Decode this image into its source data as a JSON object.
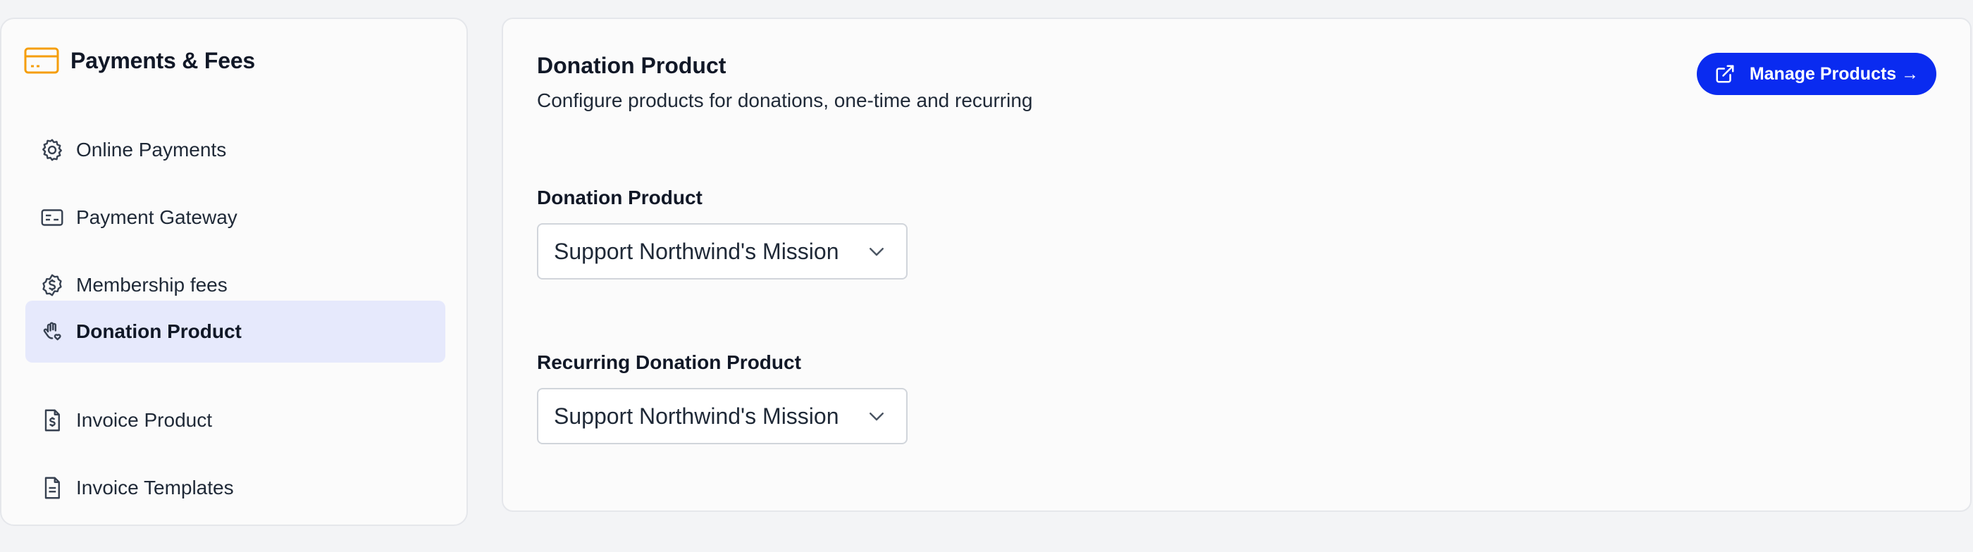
{
  "sidebar": {
    "title": "Payments & Fees",
    "items": [
      {
        "label": "Online Payments",
        "icon": "gear-icon",
        "active": false
      },
      {
        "label": "Payment Gateway",
        "icon": "card-icon",
        "active": false
      },
      {
        "label": "Membership fees",
        "icon": "dollar-badge-icon",
        "active": false
      },
      {
        "label": "Donation Product",
        "icon": "hand-heart-icon",
        "active": true
      },
      {
        "label": "Invoice Product",
        "icon": "invoice-dollar-icon",
        "active": false
      },
      {
        "label": "Invoice Templates",
        "icon": "document-icon",
        "active": false
      }
    ]
  },
  "main": {
    "title": "Donation Product",
    "subtitle": "Configure products for donations, one-time and recurring",
    "manage_button": "Manage Products →",
    "fields": [
      {
        "label": "Donation Product",
        "value": "Support Northwind's Mission"
      },
      {
        "label": "Recurring Donation Product",
        "value": "Support Northwind's Mission"
      }
    ]
  },
  "colors": {
    "accent": "#0a2bf0",
    "active_bg": "#e6e9fc",
    "header_icon": "#f59e0b"
  }
}
